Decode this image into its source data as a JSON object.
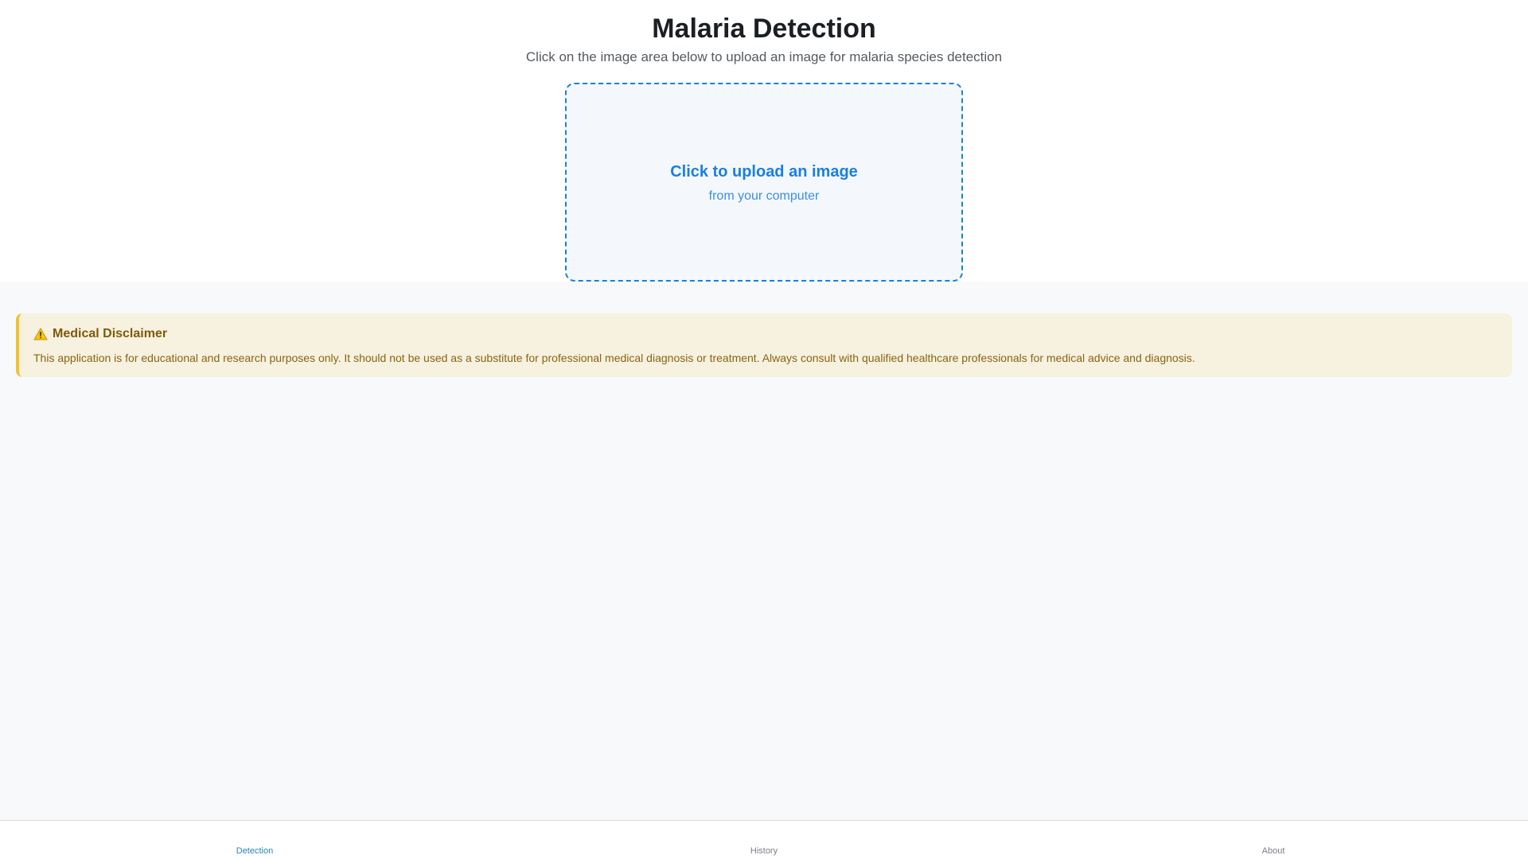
{
  "header": {
    "title": "Malaria Detection",
    "subtitle": "Click on the image area below to upload an image for malaria species detection"
  },
  "upload": {
    "title": "Click to upload an image",
    "subtitle": "from your computer",
    "accent_color": "#1a7fe0"
  },
  "disclaimer": {
    "icon": "warning-icon",
    "heading": "Medical Disclaimer",
    "text": "This application is for educational and research purposes only. It should not be used as a substitute for professional medical diagnosis or treatment. Always consult with qualified healthcare professionals for medical advice and diagnosis.",
    "background_color": "#f7f1e0",
    "border_color": "#f2c232"
  },
  "nav": {
    "tabs": [
      {
        "label": "Detection",
        "active": true
      },
      {
        "label": "History",
        "active": false
      },
      {
        "label": "About",
        "active": false
      }
    ],
    "active_color": "#2a84b8"
  }
}
